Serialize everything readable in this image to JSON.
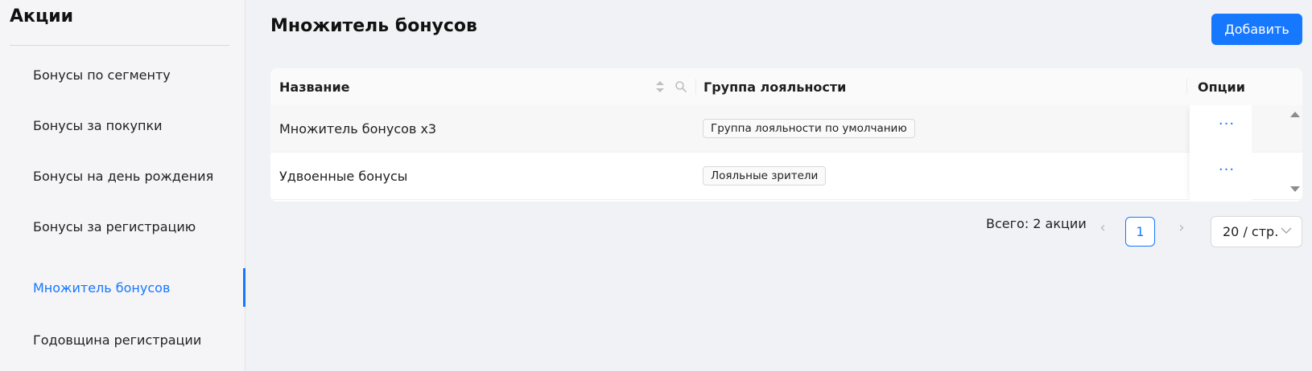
{
  "sidebar": {
    "title": "Акции",
    "items": [
      {
        "label": "Бонусы по сегменту"
      },
      {
        "label": "Бонусы за покупки"
      },
      {
        "label": "Бонусы на день рождения"
      },
      {
        "label": "Бонусы за регистрацию"
      },
      {
        "label": "Множитель бонусов",
        "active": true
      },
      {
        "label": "Годовщина регистрации"
      }
    ]
  },
  "header": {
    "title": "Множитель бонусов",
    "add_label": "Добавить"
  },
  "table": {
    "columns": {
      "name": "Название",
      "group": "Группа лояльности",
      "options": "Опции"
    },
    "rows": [
      {
        "name": "Множитель бонусов x3",
        "group": "Группа лояльности по умолчанию",
        "options": "···"
      },
      {
        "name": "Удвоенные бонусы",
        "group": "Лояльные зрители",
        "options": "···"
      }
    ]
  },
  "pagination": {
    "total": "Всего: 2 акции",
    "current_page": "1",
    "prev": "‹",
    "next": "›",
    "page_size": "20 / стр."
  },
  "colors": {
    "accent": "#1677ff",
    "background": "#f0f2f5"
  }
}
